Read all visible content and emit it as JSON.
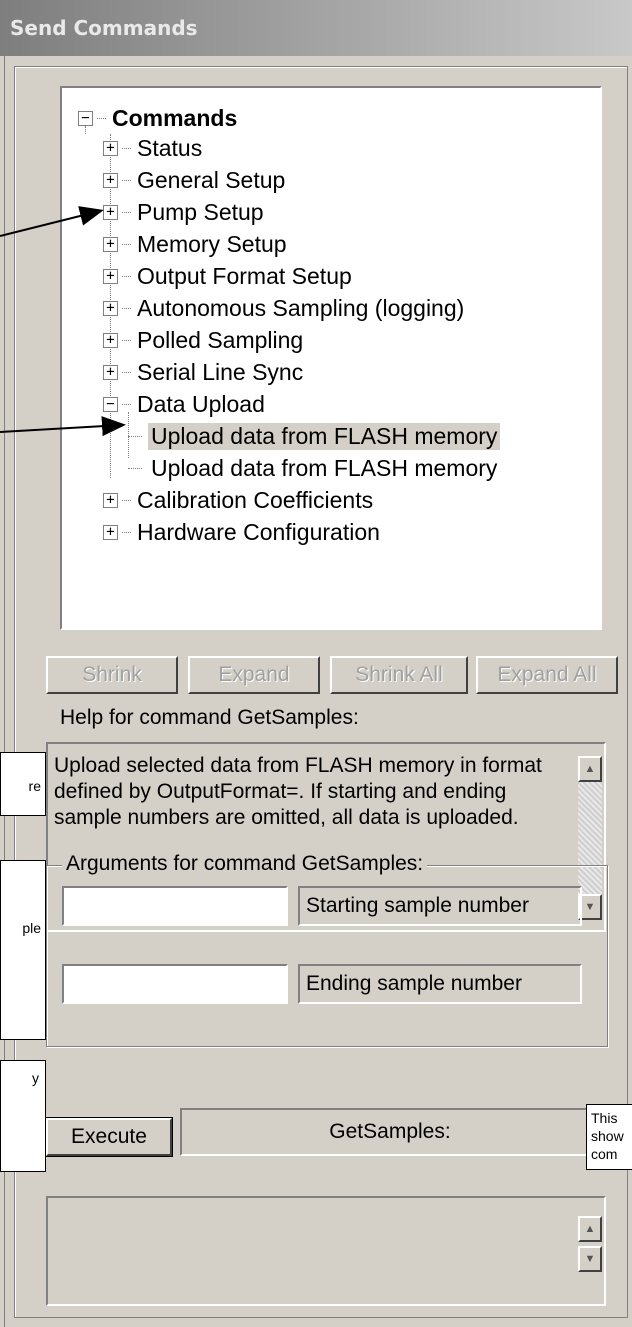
{
  "window": {
    "title": "Send Commands"
  },
  "tree": {
    "root": "Commands",
    "items": [
      {
        "label": "Status",
        "state": "collapsed"
      },
      {
        "label": "General Setup",
        "state": "collapsed"
      },
      {
        "label": "Pump Setup",
        "state": "collapsed"
      },
      {
        "label": "Memory Setup",
        "state": "collapsed"
      },
      {
        "label": "Output Format Setup",
        "state": "collapsed"
      },
      {
        "label": "Autonomous Sampling (logging)",
        "state": "collapsed"
      },
      {
        "label": "Polled Sampling",
        "state": "collapsed"
      },
      {
        "label": "Serial Line Sync",
        "state": "collapsed"
      },
      {
        "label": "Data Upload",
        "state": "expanded"
      },
      {
        "label": "Calibration Coefficients",
        "state": "collapsed"
      },
      {
        "label": "Hardware Configuration",
        "state": "collapsed"
      }
    ],
    "children": [
      {
        "label": "Upload data from FLASH memory",
        "selected": true
      },
      {
        "label": "Upload data from FLASH memory",
        "selected": false
      }
    ]
  },
  "buttons": {
    "shrink": "Shrink",
    "expand": "Expand",
    "shrink_all": "Shrink All",
    "expand_all": "Expand All",
    "execute": "Execute"
  },
  "help": {
    "label": "Help for command GetSamples:",
    "lines": [
      "Upload selected data from FLASH memory in format",
      "defined by OutputFormat=. If starting and ending",
      "sample numbers are omitted, all data is uploaded."
    ]
  },
  "arguments": {
    "title": "Arguments for command GetSamples:",
    "fields": [
      {
        "value": "",
        "label": "Starting sample number"
      },
      {
        "value": "",
        "label": "Ending sample number"
      }
    ]
  },
  "command_display": "GetSamples:",
  "callouts": {
    "left_1": "re",
    "left_2": "ple",
    "left_3": "y",
    "right_lines": [
      "This",
      "show",
      "com"
    ]
  },
  "icons": {
    "plus": "plus-box-icon",
    "minus": "minus-box-icon",
    "scroll_up": "scroll-up-arrow-icon",
    "scroll_down": "scroll-down-arrow-icon",
    "pointer_arrow": "pointer-arrow-icon"
  }
}
